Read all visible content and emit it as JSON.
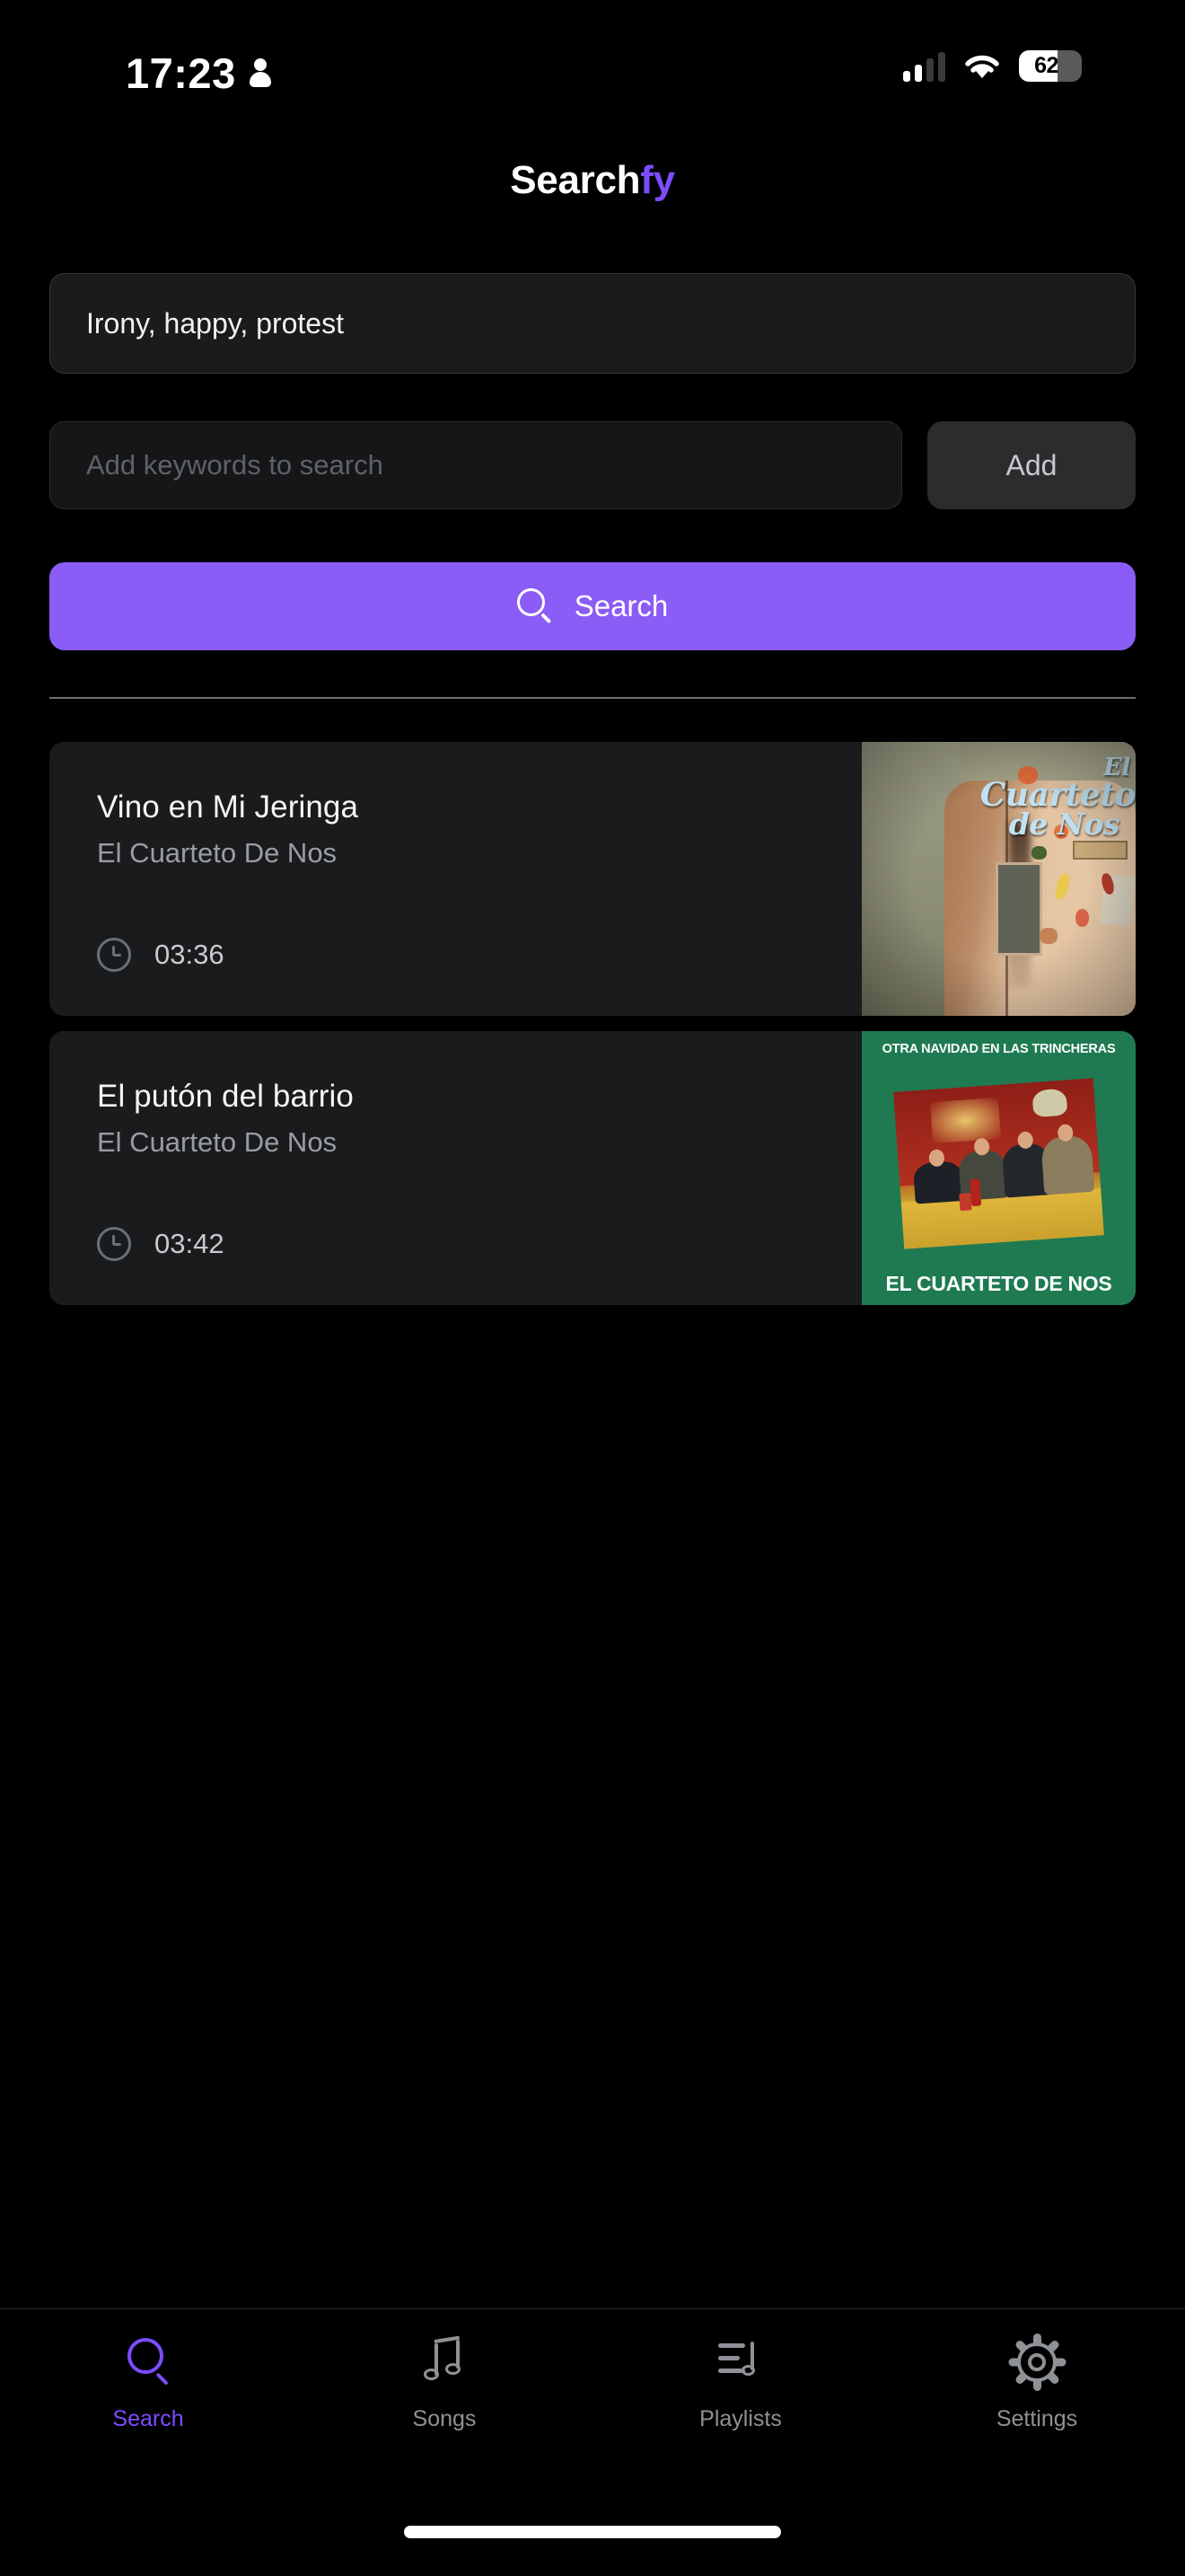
{
  "statusbar": {
    "time": "17:23",
    "person_icon": "person-icon",
    "signal_icon": "cellular-signal-icon",
    "wifi_icon": "wifi-icon",
    "battery_percent": "62",
    "battery_level": 62
  },
  "header": {
    "title_primary": "Search",
    "title_accent": "fy",
    "accent_color": "#7c4dff"
  },
  "search": {
    "keywords_value": "Irony, happy, protest",
    "input_placeholder": "Add keywords to search",
    "input_value": "",
    "add_label": "Add",
    "search_label": "Search",
    "search_icon": "magnifier-icon",
    "search_button_color": "#8b5cf6"
  },
  "results": [
    {
      "title": "Vino en Mi Jeringa",
      "artist": "El Cuarteto De Nos",
      "duration": "03:36",
      "clock_icon": "clock-icon",
      "album_art": "el-cuarteto-de-nos-fridge-cover"
    },
    {
      "title": "El putón del barrio",
      "artist": "El Cuarteto De Nos",
      "duration": "03:42",
      "clock_icon": "clock-icon",
      "album_art": "otra-navidad-en-las-trincheras-cover",
      "album_art_top_text": "OTRA NAVIDAD EN LAS TRINCHERAS",
      "album_art_bottom_text": "EL CUARTETO DE NOS"
    }
  ],
  "album_art_1": {
    "script_line1": "El",
    "script_line2": "Cuarteto",
    "script_line3": "de Nos"
  },
  "tabbar": {
    "active_color": "#7c4dff",
    "inactive_color": "#8e9195",
    "items": [
      {
        "label": "Search",
        "icon": "magnifier-icon"
      },
      {
        "label": "Songs",
        "icon": "music-note-icon"
      },
      {
        "label": "Playlists",
        "icon": "playlist-icon"
      },
      {
        "label": "Settings",
        "icon": "gear-icon"
      }
    ]
  }
}
